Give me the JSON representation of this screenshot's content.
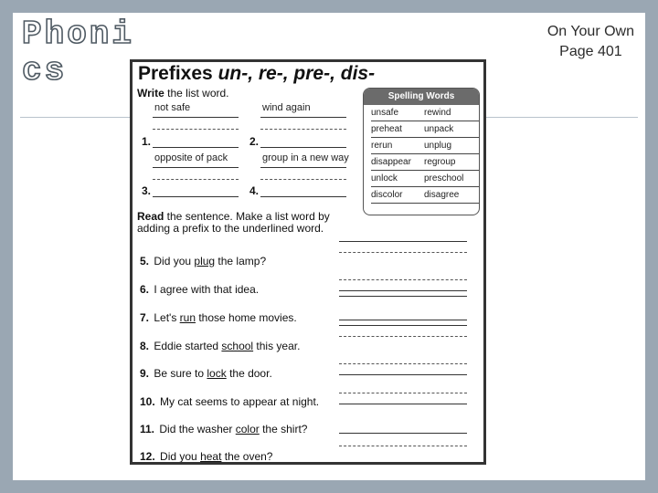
{
  "slide": {
    "title": "Phonics",
    "note_line1": "On Your Own",
    "note_line2": "Page 401"
  },
  "worksheet": {
    "title_prefix": "Prefixes ",
    "title_list": "un-, re-, pre-, dis-",
    "write_bold": "Write",
    "write_rest": " the list word.",
    "clues": [
      {
        "num": "1.",
        "text": "not safe"
      },
      {
        "num": "2.",
        "text": "wind again"
      },
      {
        "num": "3.",
        "text": "opposite of pack"
      },
      {
        "num": "4.",
        "text": "group in a new way"
      }
    ],
    "spelling_box": {
      "heading": "Spelling Words",
      "words": [
        "unsafe",
        "rewind",
        "preheat",
        "unpack",
        "rerun",
        "unplug",
        "disappear",
        "regroup",
        "unlock",
        "preschool",
        "discolor",
        "disagree"
      ]
    },
    "read_bold": "Read",
    "read_rest": " the sentence. Make a list word by adding a prefix to the underlined word.",
    "questions": [
      {
        "num": "5.",
        "before": "Did you ",
        "underlined": "plug",
        "after": " the lamp?"
      },
      {
        "num": "6.",
        "before": "I agree with that idea.",
        "underlined": "",
        "after": ""
      },
      {
        "num": "7.",
        "before": "Let's ",
        "underlined": "run",
        "after": " those home movies."
      },
      {
        "num": "8.",
        "before": "Eddie started ",
        "underlined": "school",
        "after": " this year."
      },
      {
        "num": "9.",
        "before": "Be sure to ",
        "underlined": "lock",
        "after": " the door."
      },
      {
        "num": "10.",
        "before": "My cat seems to appear at night.",
        "underlined": "",
        "after": ""
      },
      {
        "num": "11.",
        "before": "Did the washer ",
        "underlined": "color",
        "after": " the shirt?"
      },
      {
        "num": "12.",
        "before": "Did you ",
        "underlined": "heat",
        "after": " the oven?"
      }
    ]
  }
}
